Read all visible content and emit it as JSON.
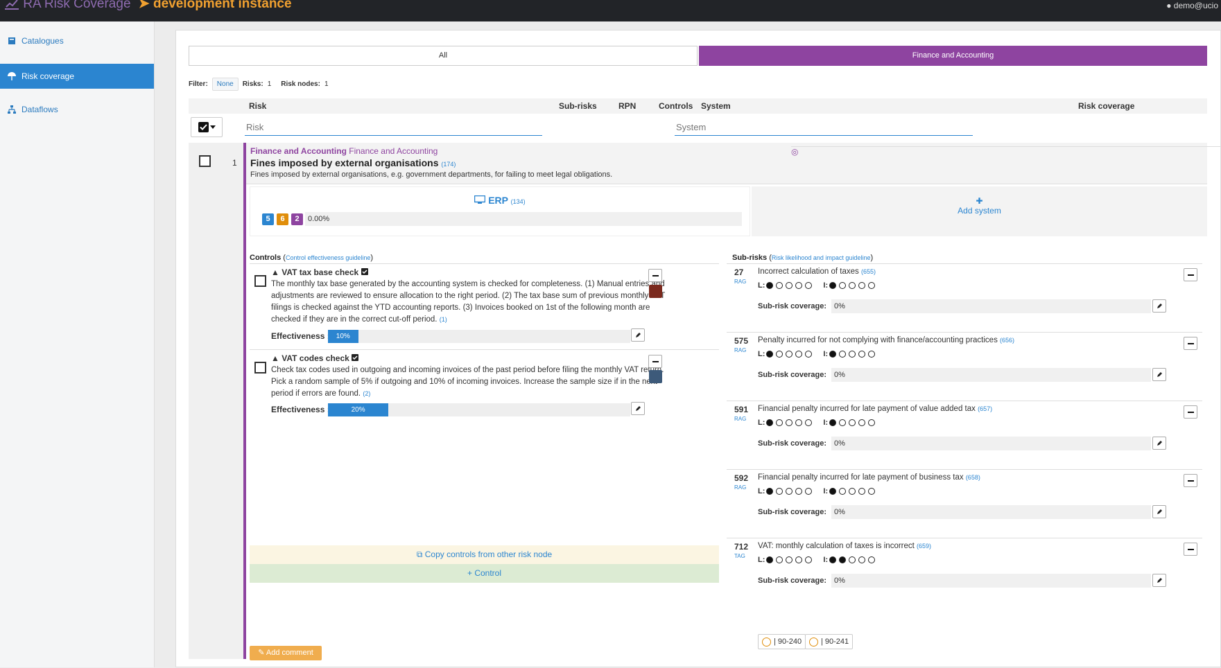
{
  "topbar": {
    "app_title": "RA Risk Coverage",
    "instance": "development instance",
    "user": "demo@ucio"
  },
  "sidebar": {
    "items": [
      {
        "label": "Catalogues",
        "icon": "book-icon",
        "active": false
      },
      {
        "label": "Risk coverage",
        "icon": "umbrella-icon",
        "active": true
      },
      {
        "label": "Dataflows",
        "icon": "sitemap-icon",
        "active": false
      }
    ]
  },
  "tabs": {
    "all": "All",
    "finance": "Finance and Accounting"
  },
  "filterbar": {
    "filter_label": "Filter:",
    "filter_value": "None",
    "risks_label": "Risks:",
    "risks_count": "1",
    "nodes_label": "Risk nodes:",
    "nodes_count": "1"
  },
  "table": {
    "headers": {
      "risk": "Risk",
      "subrisks": "Sub-risks",
      "rpn": "RPN",
      "controls": "Controls",
      "system": "System",
      "coverage": "Risk coverage"
    },
    "risk_filter_placeholder": "Risk",
    "system_filter_placeholder": "System"
  },
  "row": {
    "number": "1",
    "category": "Finance and Accounting",
    "node": "Finance and Accounting",
    "title": "Fines imposed by external organisations",
    "ref": "(174)",
    "description": "Fines imposed by external organisations, e.g. government departments, for failing to meet legal obligations."
  },
  "system": {
    "name": "ERP",
    "ref": "(134)",
    "badges": [
      {
        "value": "5",
        "color": "#2b85d0"
      },
      {
        "value": "6",
        "color": "#e08e0b"
      },
      {
        "value": "2",
        "color": "#8e44a0"
      }
    ],
    "coverage": "0.00%",
    "add_system": "Add system"
  },
  "controls": {
    "title": "Controls",
    "guideline": "Control effectiveness guideline",
    "items": [
      {
        "name": "VAT tax base check",
        "description": "The monthly tax base generated by the accounting system is checked for completeness. (1) Manual entries and adjustments are reviewed to ensure allocation to the right period. (2) The tax base sum of previous monthly VAT filings is checked against the YTD accounting reports. (3) Invoices booked on 1st of the following month are checked if they are in the correct cut-off period.",
        "ref": "(1)",
        "effectiveness_label": "Effectiveness :",
        "effectiveness": "10%",
        "effectiveness_value": 0.1,
        "color": "#7b2a1e"
      },
      {
        "name": "VAT codes check",
        "description": "Check tax codes used in outgoing and incoming invoices of the past period before filing the monthly VAT return. Pick a random sample of 5% if outgoing and 10% of incoming invoices. Increase the sample size if in the next period if errors are found.",
        "ref": "(2)",
        "effectiveness_label": "Effectiveness :",
        "effectiveness": "20%",
        "effectiveness_value": 0.2,
        "color": "#3d5a7a"
      }
    ],
    "copy_label": "Copy controls from other risk node",
    "add_control": "+ Control",
    "add_comment": "Add comment"
  },
  "subrisks": {
    "title": "Sub-risks",
    "guideline": "Risk likelihood and impact guideline",
    "coverage_label": "Sub-risk coverage:",
    "items": [
      {
        "id": "27",
        "tag": "RAG",
        "title": "Incorrect calculation of taxes",
        "ref": "(655)",
        "likelihood": 1,
        "impact": 1,
        "coverage": "0%"
      },
      {
        "id": "575",
        "tag": "RAG",
        "title": "Penalty incurred for not complying with finance/accounting practices",
        "ref": "(656)",
        "likelihood": 1,
        "impact": 1,
        "coverage": "0%"
      },
      {
        "id": "591",
        "tag": "RAG",
        "title": "Financial penalty incurred for late payment of value added tax",
        "ref": "(657)",
        "likelihood": 1,
        "impact": 1,
        "coverage": "0%"
      },
      {
        "id": "592",
        "tag": "RAG",
        "title": "Financial penalty incurred for late payment of business tax",
        "ref": "(658)",
        "likelihood": 1,
        "impact": 1,
        "coverage": "0%"
      },
      {
        "id": "712",
        "tag": "TAG",
        "title": "VAT: monthly calculation of taxes is incorrect",
        "ref": "(659)",
        "likelihood": 1,
        "impact": 2,
        "coverage": "0%"
      }
    ],
    "tags": [
      "| 90-240",
      "| 90-241"
    ]
  }
}
